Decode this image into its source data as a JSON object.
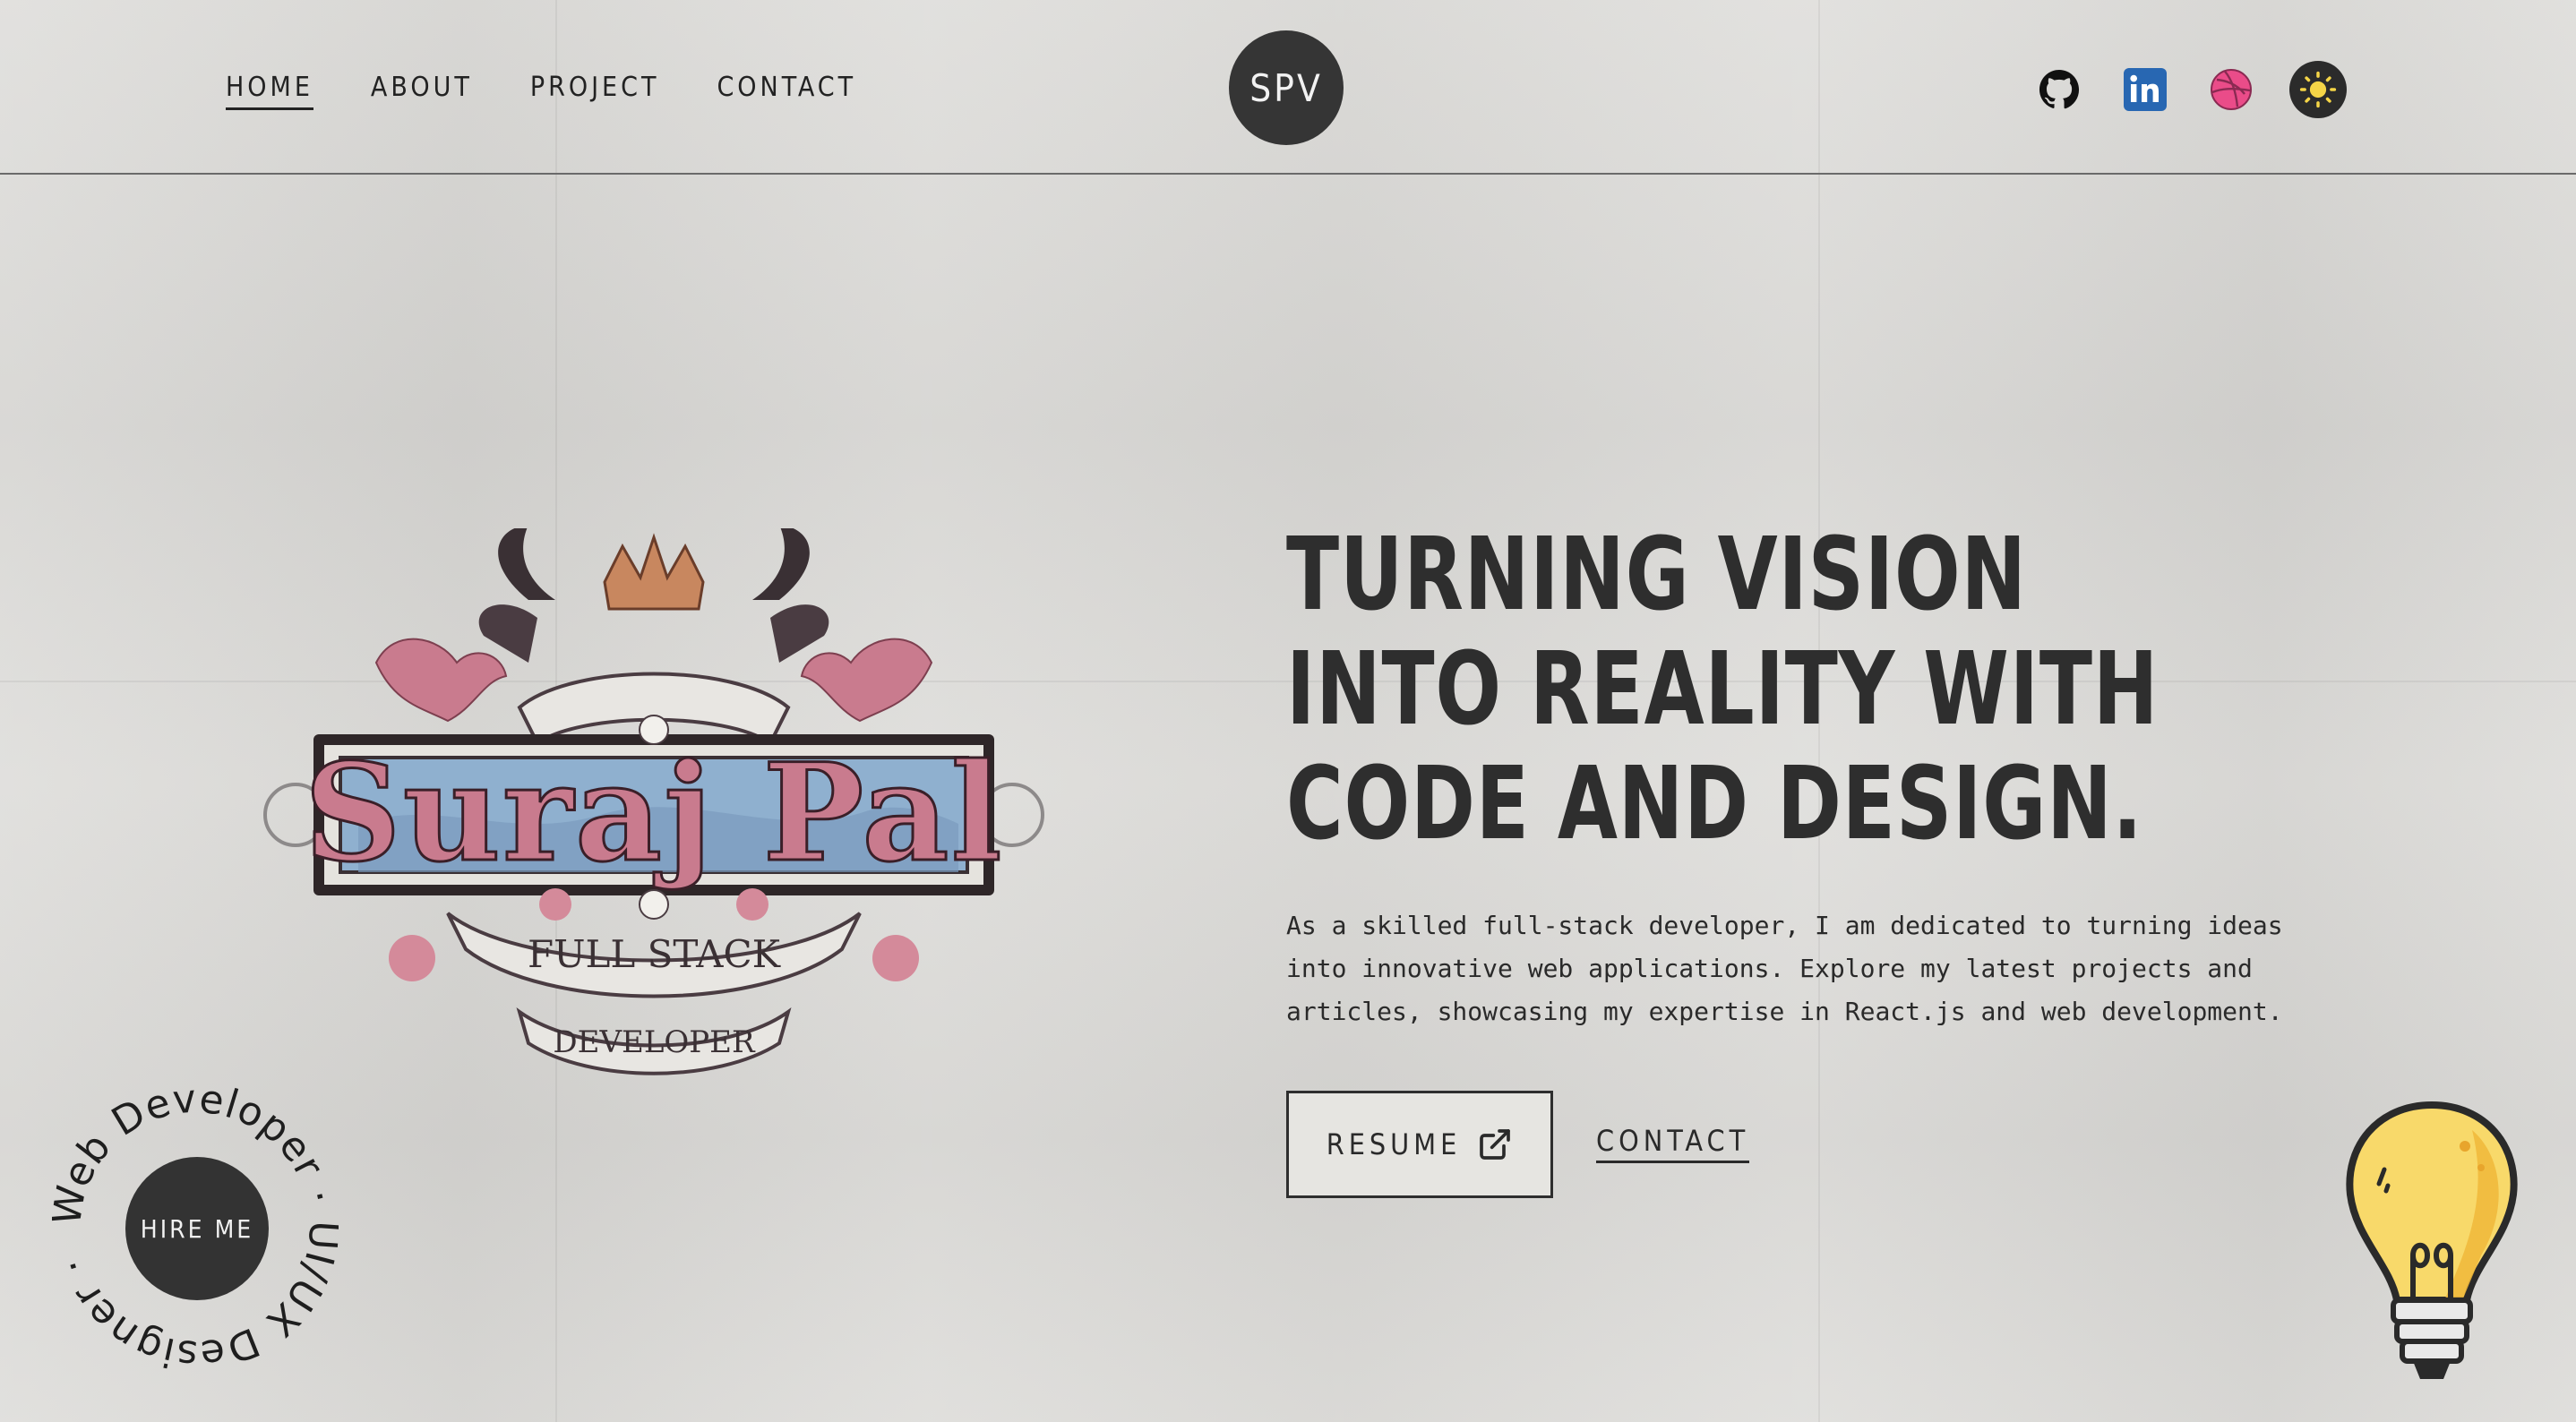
{
  "nav": {
    "items": [
      {
        "label": "HOME",
        "active": true
      },
      {
        "label": "ABOUT",
        "active": false
      },
      {
        "label": "PROJECT",
        "active": false
      },
      {
        "label": "CONTACT",
        "active": false
      }
    ]
  },
  "logo": {
    "text": "SPV"
  },
  "socials": [
    {
      "name": "github-icon"
    },
    {
      "name": "linkedin-icon"
    },
    {
      "name": "dribbble-icon"
    },
    {
      "name": "theme-toggle-sun-icon"
    }
  ],
  "emblem": {
    "name": "Suraj Pal",
    "banner_top": "FULL STACK",
    "banner_bottom": "DEVELOPER"
  },
  "hero": {
    "title": "TURNING VISION INTO REALITY WITH CODE AND DESIGN.",
    "description": "As a skilled full-stack developer, I am dedicated to turning ideas into innovative web applications. Explore my latest projects and articles, showcasing my expertise in React.js and web development.",
    "resume_label": "RESUME",
    "contact_label": "CONTACT"
  },
  "hire": {
    "button_label": "HIRE ME",
    "ring_text": "Web Developer · UI/UX Designer ·"
  },
  "colors": {
    "background": "#dcdbd8",
    "dark": "#333333",
    "linkedin": "#2867b2",
    "dribbble": "#ea4c89",
    "sun": "#f5d547",
    "emblem_pink": "#c97b8e",
    "emblem_blue": "#8fb0cf"
  }
}
